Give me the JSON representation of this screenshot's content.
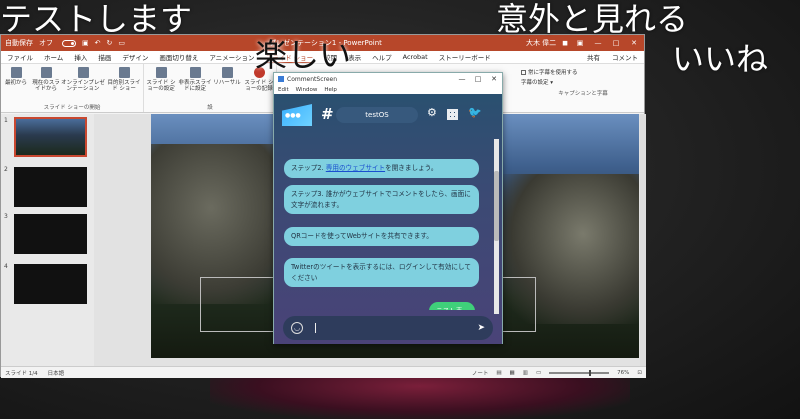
{
  "overlay": {
    "top_left": "テストします",
    "top_right": "意外と見れる",
    "right2": "いいね",
    "center": "楽しい"
  },
  "powerpoint": {
    "autosave_label": "自動保存",
    "autosave_state": "オフ",
    "title": "プレゼンテーション1 - PowerPoint",
    "user": "大木 偉二",
    "tabs": [
      "ファイル",
      "ホーム",
      "挿入",
      "描画",
      "デザイン",
      "画面切り替え",
      "アニメーション",
      "スライド ショー",
      "校閲",
      "表示",
      "ヘルプ",
      "Acrobat",
      "ストーリーボード"
    ],
    "active_tab": "スライド ショー",
    "share": "共有",
    "comment": "コメント",
    "ribbon": {
      "start_group": "スライド ショーの開始",
      "btn_from_start": "最初から",
      "btn_from_current": "現在のスライドから",
      "btn_online": "オンラインプレゼンテーション",
      "btn_custom": "目的別スライド ショー",
      "btn_setup": "スライド ショーの設定",
      "btn_hide": "非表示スライドに設定",
      "btn_rehearse": "リハーサル",
      "btn_record": "スライド ショーの記録",
      "group2": "設",
      "caption_always": "常に字幕を使用する",
      "caption_settings": "字幕の設定",
      "caption_group": "キャプションと字幕"
    },
    "slide_numbers": [
      "1",
      "2",
      "3",
      "4"
    ],
    "status": {
      "slide": "スライド 1/4",
      "lang": "日本語",
      "notes": "ノート",
      "zoom": "76%"
    }
  },
  "comment_screen": {
    "title": "CommentScreen",
    "menu": [
      "Edit",
      "Window",
      "Help"
    ],
    "brand": "●●●",
    "hash": "#",
    "room": "testOS",
    "messages": [
      {
        "pre": "ステップ2. ",
        "link": "専用のウェブサイト",
        "post": "を開きましょう。"
      },
      {
        "text": "ステップ3. 誰かがウェブサイトでコメントをしたら、画面に文字が流れます。"
      },
      {
        "text": "QRコードを使ってWebサイトを共有できます。"
      },
      {
        "text": "Twitterのツイートを表示するには、ログインして有効にしてください"
      },
      {
        "text": "テスト表示"
      }
    ],
    "input_placeholder": ""
  }
}
